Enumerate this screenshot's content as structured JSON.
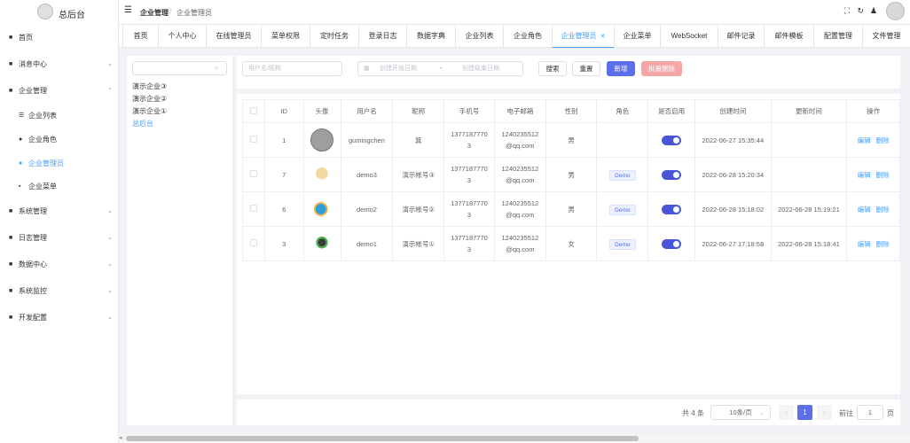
{
  "app": {
    "title": "总后台"
  },
  "sidebar": {
    "items": [
      {
        "label": "首页",
        "icon": "home-icon",
        "arrow": ""
      },
      {
        "label": "消息中心",
        "icon": "message-icon",
        "arrow": "⌄"
      },
      {
        "label": "企业管理",
        "icon": "enterprise-icon",
        "arrow": "⌃"
      },
      {
        "label": "企业列表",
        "icon": "list-icon",
        "arrow": ""
      },
      {
        "label": "企业角色",
        "icon": "role-icon",
        "arrow": ""
      },
      {
        "label": "企业管理员",
        "icon": "admin-icon",
        "arrow": ""
      },
      {
        "label": "企业菜单",
        "icon": "grid-icon",
        "arrow": ""
      },
      {
        "label": "系统管理",
        "icon": "system-icon",
        "arrow": "⌄"
      },
      {
        "label": "日志管理",
        "icon": "log-icon",
        "arrow": "⌄"
      },
      {
        "label": "数据中心",
        "icon": "data-icon",
        "arrow": "⌄"
      },
      {
        "label": "系统监控",
        "icon": "monitor-icon",
        "arrow": "⌄"
      },
      {
        "label": "开发配置",
        "icon": "dev-icon",
        "arrow": "⌄"
      }
    ]
  },
  "breadcrumb": {
    "parent": "企业管理",
    "separator": "/",
    "current": "企业管理员"
  },
  "tabs": [
    {
      "label": "首页"
    },
    {
      "label": "个人中心"
    },
    {
      "label": "在线管理员"
    },
    {
      "label": "菜单权限"
    },
    {
      "label": "定时任务"
    },
    {
      "label": "登录日志"
    },
    {
      "label": "数据字典"
    },
    {
      "label": "企业列表"
    },
    {
      "label": "企业角色"
    },
    {
      "label": "企业管理员"
    },
    {
      "label": "企业菜单"
    },
    {
      "label": "WebSocket"
    },
    {
      "label": "邮件记录"
    },
    {
      "label": "邮件模板"
    },
    {
      "label": "配置管理"
    },
    {
      "label": "文件管理"
    }
  ],
  "tree": {
    "search_placeholder": "",
    "nodes": [
      {
        "label": "演示企业③"
      },
      {
        "label": "演示企业②"
      },
      {
        "label": "演示企业①"
      },
      {
        "label": "总后台"
      }
    ]
  },
  "filters": {
    "keyword_placeholder": "用户名/昵称",
    "start_placeholder": "创建开始日期",
    "range_sep": "-",
    "end_placeholder": "创建结束日期",
    "search_label": "搜索",
    "reset_label": "重置",
    "add_label": "新增",
    "batch_delete_label": "批量删除"
  },
  "table": {
    "headers": [
      "",
      "ID",
      "头像",
      "用户名",
      "昵称",
      "手机号",
      "电子邮箱",
      "性别",
      "角色",
      "是否启用",
      "创建时间",
      "更新时间",
      "操作"
    ],
    "edit_label": "编辑",
    "delete_label": "删除",
    "rows": [
      {
        "id": "1",
        "username": "gumingchen",
        "nickname": "箕",
        "phone1": "1377187770",
        "phone2": "3",
        "email1": "1240235512",
        "email2": "@qq.com",
        "gender": "男",
        "role": "",
        "created": "2022-06-27 15:35:44",
        "updated": "",
        "avatar": "avatar-gray"
      },
      {
        "id": "7",
        "username": "demo3",
        "nickname": "演示帐号③",
        "phone1": "1377187770",
        "phone2": "3",
        "email1": "1240235512",
        "email2": "@qq.com",
        "gender": "男",
        "role": "Demo",
        "created": "2022-06-28 15:20:34",
        "updated": "",
        "avatar": "avatar-cat"
      },
      {
        "id": "6",
        "username": "demo2",
        "nickname": "演示帐号②",
        "phone1": "1377187770",
        "phone2": "3",
        "email1": "1240235512",
        "email2": "@qq.com",
        "gender": "男",
        "role": "Demo",
        "created": "2022-06-28 15:18:02",
        "updated": "2022-06-28 15:19:21",
        "avatar": "avatar-bird"
      },
      {
        "id": "3",
        "username": "demo1",
        "nickname": "演示帐号①",
        "phone1": "1377187770",
        "phone2": "3",
        "email1": "1240235512",
        "email2": "@qq.com",
        "gender": "女",
        "role": "Demo",
        "created": "2022-06-27 17:18:58",
        "updated": "2022-06-28 15:18:41",
        "avatar": "avatar-figure"
      }
    ]
  },
  "pagination": {
    "total_label": "共 4 条",
    "page_size": "10条/页",
    "current_page": "1",
    "goto_label": "前往",
    "goto_value": "1",
    "page_unit": "页"
  },
  "colors": {
    "primary": "#409eff",
    "accent": "#5b6fe8",
    "danger_light": "#f7a6a6"
  }
}
